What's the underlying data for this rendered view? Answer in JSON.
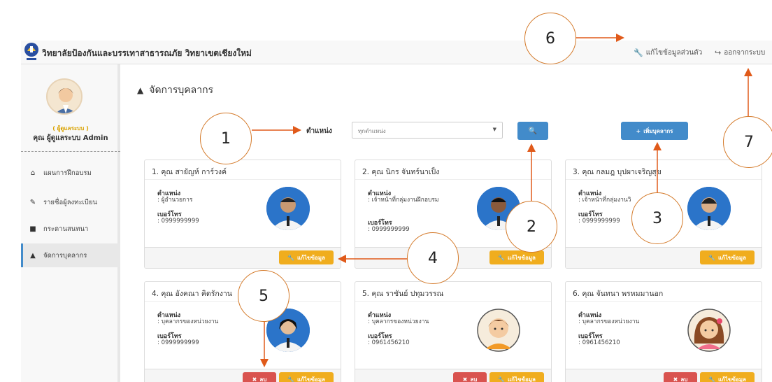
{
  "navbar": {
    "title": "วิทยาลัยป้องกันและบรรเทาสาธารณภัย วิทยาเขตเชียงใหม่",
    "edit_profile": "แก้ไขข้อมูลส่วนตัว",
    "logout": "ออกจากระบบ"
  },
  "sidebar": {
    "role": "( ผู้ดูแลระบบ )",
    "username": "คุณ ผู้ดูแลระบบ Admin",
    "items": [
      {
        "label": "แผนการฝึกอบรม",
        "icon": "home-icon"
      },
      {
        "label": "รายชื่อผู้ลงทะเบียน",
        "icon": "pencil-icon"
      },
      {
        "label": "กระดานสนทนา",
        "icon": "bookmark-icon"
      },
      {
        "label": "จัดการบุคลากร",
        "icon": "user-icon"
      }
    ]
  },
  "main": {
    "title": "จัดการบุคลากร",
    "filter_label": "ตำแหน่ง",
    "filter_value": "ทุกตำแหน่ง",
    "add_button": "เพิ่มบุคลากร"
  },
  "cards": [
    {
      "name": "1. คุณ สายัญห์ การ์วงค์",
      "k_pos": "ตำแหน่ง",
      "position": ": ผู้อำนวยการ",
      "k_phone": "เบอร์โทร",
      "phone": ": 0999999999",
      "edit": "แก้ไขข้อมูล",
      "delete": ""
    },
    {
      "name": "2. คุณ นิกร จันทร์นาเป็ง",
      "k_pos": "ตำแหน่ง",
      "position": ": เจ้าหน้าที่กลุ่มงานฝึกอบรม",
      "k_phone": "เบอร์โทร",
      "phone": ": 0999999999",
      "edit": "แก้ไขข้อมูล",
      "delete": ""
    },
    {
      "name": "3. คุณ กลมฎ บุปผาเจริญสุข",
      "k_pos": "ตำแหน่ง",
      "position": ": เจ้าหน้าที่กลุ่มงานวิ",
      "k_phone": "เบอร์โทร",
      "phone": ": 0999999999",
      "edit": "แก้ไขข้อมูล",
      "delete": ""
    },
    {
      "name": "4. คุณ อังคณา คิดรักงาน",
      "k_pos": "ตำแหน่ง",
      "position": ": บุคลากรของหน่วยงาน",
      "k_phone": "เบอร์โทร",
      "phone": ": 0999999999",
      "edit": "แก้ไขข้อมูล",
      "delete": "ลบ"
    },
    {
      "name": "5. คุณ ราชันย์ ปทุมวรรณ",
      "k_pos": "ตำแหน่ง",
      "position": ": บุคลากรของหน่วยงาน",
      "k_phone": "เบอร์โทร",
      "phone": ": 0961456210",
      "edit": "แก้ไขข้อมูล",
      "delete": "ลบ"
    },
    {
      "name": "6. คุณ จันทนา พรหมมานอก",
      "k_pos": "ตำแหน่ง",
      "position": ": บุคลากรของหน่วยงาน",
      "k_phone": "เบอร์โทร",
      "phone": ": 0961456210",
      "edit": "แก้ไขข้อมูล",
      "delete": "ลบ"
    }
  ],
  "callouts": [
    "1",
    "2",
    "3",
    "4",
    "5",
    "6",
    "7"
  ],
  "colors": {
    "primary": "#428bca",
    "warning": "#f0ad1e",
    "danger": "#d9534f",
    "callout_border": "#d47a2a"
  }
}
